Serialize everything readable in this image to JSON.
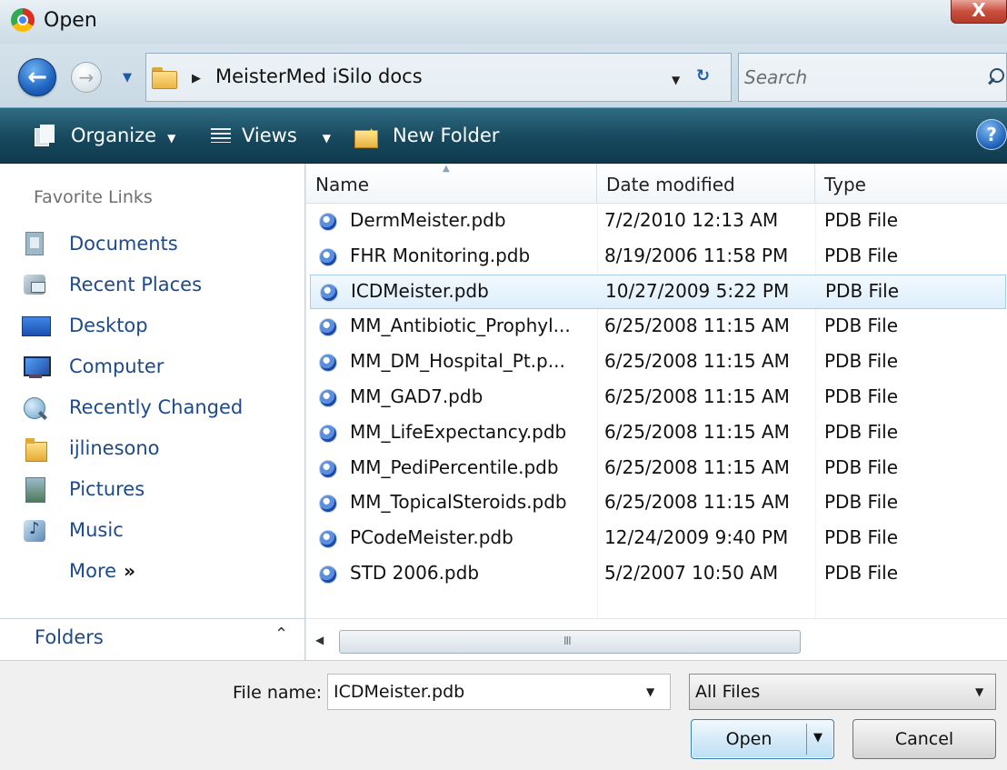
{
  "window": {
    "title": "Open",
    "close_glyph": "X"
  },
  "nav": {
    "breadcrumb": "MeisterMed iSilo docs",
    "search_placeholder": "Search"
  },
  "toolbar": {
    "organize": "Organize",
    "views": "Views",
    "new_folder": "New Folder",
    "help_glyph": "?"
  },
  "sidebar": {
    "heading": "Favorite Links",
    "items": [
      {
        "label": "Documents",
        "icon": "documents-icon"
      },
      {
        "label": "Recent Places",
        "icon": "recent-places-icon"
      },
      {
        "label": "Desktop",
        "icon": "desktop-icon"
      },
      {
        "label": "Computer",
        "icon": "computer-icon"
      },
      {
        "label": "Recently Changed",
        "icon": "recently-changed-icon"
      },
      {
        "label": "ijlinesono",
        "icon": "user-folder-icon"
      },
      {
        "label": "Pictures",
        "icon": "pictures-icon"
      },
      {
        "label": "Music",
        "icon": "music-icon"
      }
    ],
    "more": "More",
    "more_glyph": "»",
    "folders": "Folders"
  },
  "filelist": {
    "columns": {
      "name": "Name",
      "date": "Date modified",
      "type": "Type"
    },
    "selected_index": 2,
    "rows": [
      {
        "name": "DermMeister.pdb",
        "date": "7/2/2010 12:13 AM",
        "type": "PDB File"
      },
      {
        "name": "FHR Monitoring.pdb",
        "date": "8/19/2006 11:58 PM",
        "type": "PDB File"
      },
      {
        "name": "ICDMeister.pdb",
        "date": "10/27/2009 5:22 PM",
        "type": "PDB File"
      },
      {
        "name": "MM_Antibiotic_Prophyl...",
        "date": "6/25/2008 11:15 AM",
        "type": "PDB File"
      },
      {
        "name": "MM_DM_Hospital_Pt.p...",
        "date": "6/25/2008 11:15 AM",
        "type": "PDB File"
      },
      {
        "name": "MM_GAD7.pdb",
        "date": "6/25/2008 11:15 AM",
        "type": "PDB File"
      },
      {
        "name": "MM_LifeExpectancy.pdb",
        "date": "6/25/2008 11:15 AM",
        "type": "PDB File"
      },
      {
        "name": "MM_PediPercentile.pdb",
        "date": "6/25/2008 11:15 AM",
        "type": "PDB File"
      },
      {
        "name": "MM_TopicalSteroids.pdb",
        "date": "6/25/2008 11:15 AM",
        "type": "PDB File"
      },
      {
        "name": "PCodeMeister.pdb",
        "date": "12/24/2009 9:40 PM",
        "type": "PDB File"
      },
      {
        "name": "STD 2006.pdb",
        "date": "5/2/2007 10:50 AM",
        "type": "PDB File"
      }
    ]
  },
  "footer": {
    "file_name_label": "File name:",
    "file_name_value": "ICDMeister.pdb",
    "file_type": "All Files",
    "open": "Open",
    "cancel": "Cancel"
  }
}
